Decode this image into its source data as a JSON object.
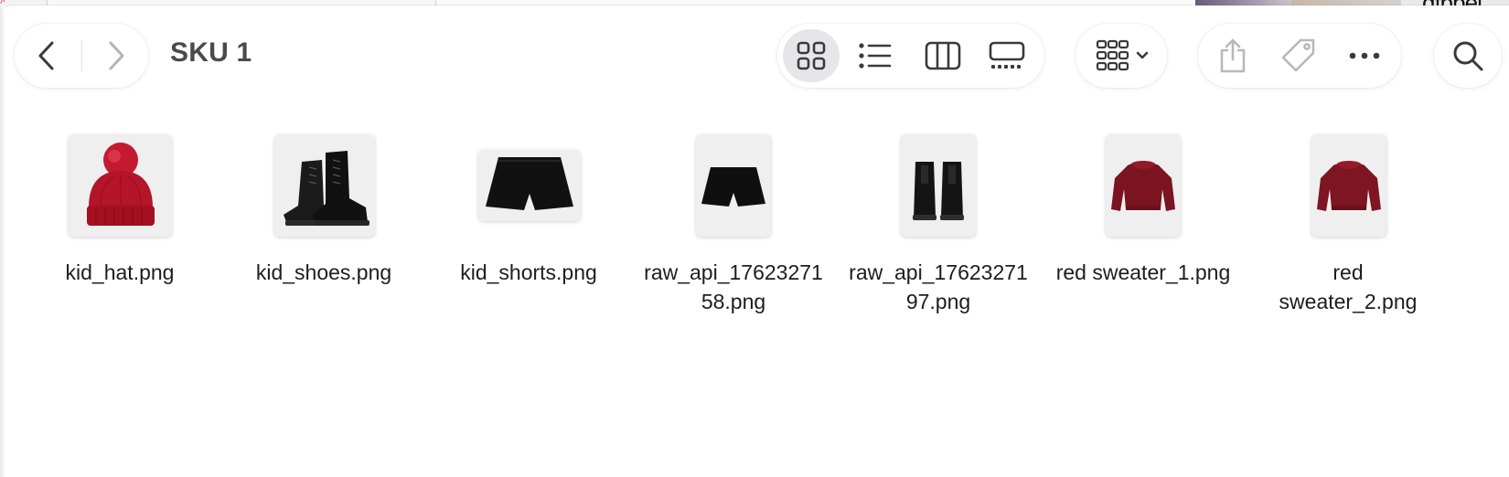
{
  "window": {
    "title": "SKU 1"
  },
  "toolbar": {
    "nav": [
      "chevron-left-icon",
      "chevron-right-icon"
    ],
    "views": [
      "icon-view",
      "list-view",
      "column-view",
      "gallery-view"
    ],
    "active_view": "icon-view",
    "actions": [
      "share-icon",
      "tag-icon",
      "more-icon",
      "search-icon"
    ]
  },
  "files": [
    {
      "name": "kid_hat.png"
    },
    {
      "name": "kid_shoes.png"
    },
    {
      "name": "kid_shorts.png"
    },
    {
      "name": "raw_api_1762327158.png",
      "line1": "raw_api_17623271",
      "line2": "58.png"
    },
    {
      "name": "raw_api_1762327197.png",
      "line1": "raw_api_17623271",
      "line2": "97.png"
    },
    {
      "name": "red sweater_1.png"
    },
    {
      "name": "red sweater_2.png",
      "line1": "red",
      "line2": "sweater_2.png"
    }
  ],
  "colors": {
    "hat_red": "#c0122a",
    "sweater_red": "#7a1420",
    "black": "#141414",
    "accent_bg": "#e6e6e8"
  }
}
